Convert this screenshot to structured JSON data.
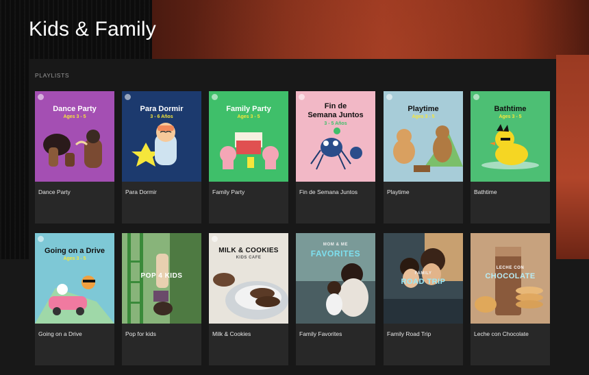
{
  "page": {
    "title": "Kids & Family"
  },
  "section": {
    "label": "PLAYLISTS"
  },
  "colors": {
    "card_bg": "#282828",
    "page_bg": "#181818",
    "cover_purple": "#a44fb3",
    "cover_navy": "#1c3a6e",
    "cover_green": "#3fbf6a",
    "cover_pink": "#f2b8c6",
    "cover_sky": "#a7ccd8",
    "cover_green2": "#4dbf74",
    "accent_yellow": "#f5e63b"
  },
  "playlists": [
    {
      "title": "Dance Party",
      "cover": {
        "line1": "Dance Party",
        "line2": "Ages 3 - 5"
      }
    },
    {
      "title": "Para Dormir",
      "cover": {
        "line1": "Para Dormir",
        "line2": "3 - 6 Años"
      }
    },
    {
      "title": "Family Party",
      "cover": {
        "line1": "Family Party",
        "line2": "Ages 3 - 5"
      }
    },
    {
      "title": "Fin de Semana Juntos",
      "cover": {
        "line1": "Fin de",
        "line1b": "Semana Juntos",
        "line2": "3 - 5 Años"
      }
    },
    {
      "title": "Playtime",
      "cover": {
        "line1": "Playtime",
        "line2": "Ages 3 - 5"
      }
    },
    {
      "title": "Bathtime",
      "cover": {
        "line1": "Bathtime",
        "line2": "Ages 3 - 5"
      }
    },
    {
      "title": "Going on a Drive",
      "cover": {
        "line1": "Going on a Drive",
        "line2": "Ages 3 - 5"
      }
    },
    {
      "title": "Pop for kids",
      "cover": {
        "line1": "POP 4 KIDS"
      }
    },
    {
      "title": "Milk & Cookies",
      "cover": {
        "line1": "MILK & COOKIES",
        "line2": "KIDS CAFE"
      }
    },
    {
      "title": "Family Favorites",
      "cover": {
        "line0": "MOM & ME",
        "line1": "FAVORITES"
      }
    },
    {
      "title": "Family Road Trip",
      "cover": {
        "line0": "FAMILY",
        "line1": "ROAD TRIP"
      }
    },
    {
      "title": "Leche con Chocolate",
      "cover": {
        "line0": "LECHE CON",
        "line1": "CHOCOLATE"
      }
    }
  ]
}
